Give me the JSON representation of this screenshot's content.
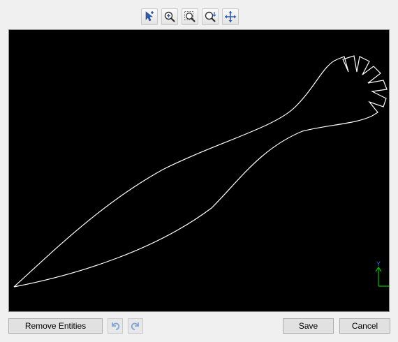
{
  "toolbar": {
    "items": [
      {
        "icon": "select-pointer-icon"
      },
      {
        "icon": "zoom-in-icon"
      },
      {
        "icon": "zoom-window-icon"
      },
      {
        "icon": "zoom-extents-icon"
      },
      {
        "icon": "pan-icon"
      }
    ]
  },
  "viewport": {
    "background": "#000000",
    "line_color": "#ffffff",
    "axis_color": "#00c000",
    "axis_label_color": "#3a6cff",
    "axis_label": "Y"
  },
  "footer": {
    "remove_label": "Remove Entities",
    "undo_icon": "undo-icon",
    "redo_icon": "redo-icon",
    "save_label": "Save",
    "cancel_label": "Cancel"
  }
}
